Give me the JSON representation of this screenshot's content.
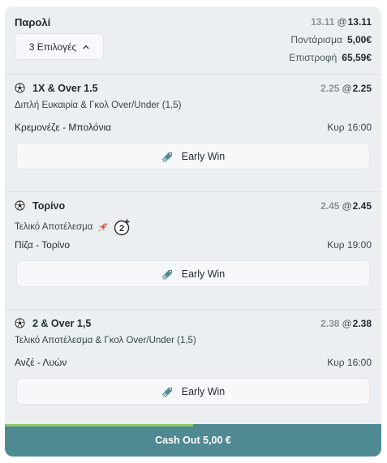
{
  "header": {
    "title": "Παρολί",
    "selections_button": "3 Επιλογές",
    "odds_old": "13.11",
    "odds_at": "@",
    "odds_new": "13.11",
    "stake_label": "Ποντάρισμα",
    "stake_value": "5,00€",
    "return_label": "Επιστροφή",
    "return_value": "65,59€"
  },
  "selections": [
    {
      "market": "1X & Over 1.5",
      "odds_old": "2.25",
      "odds_new": "2.25",
      "subtitle": "Διπλή Ευκαιρία & Γκολ Over/Under (1,5)",
      "event": "Κρεμονέζε - Μπολόνια",
      "time": "Κυρ 16:00",
      "early_win": "Early Win"
    },
    {
      "market": "Τορίνο",
      "odds_old": "2.45",
      "odds_new": "2.45",
      "subtitle": "Τελικό Αποτέλεσμα",
      "badge": "2",
      "event": "Πίζα - Τορίνο",
      "time": "Κυρ 19:00",
      "early_win": "Early Win"
    },
    {
      "market": "2 & Over 1,5",
      "odds_old": "2.38",
      "odds_new": "2.38",
      "subtitle": "Τελικό Αποτέλεσμα & Γκολ Over/Under (1,5)",
      "event": "Ανζέ - Λυών",
      "time": "Κυρ 16:00",
      "early_win": "Early Win"
    }
  ],
  "cashout": {
    "label": "Cash Out 5,00 €",
    "progress": 0.5
  },
  "colors": {
    "cashout_bg": "#4f8a93",
    "cashout_progress": "#8cc66b",
    "panel_bg": "#eceff1"
  },
  "icons": [
    "soccer-ball-icon",
    "chevron-up-icon",
    "rocket-icon",
    "early-win-icon",
    "boost-badge-icon"
  ]
}
